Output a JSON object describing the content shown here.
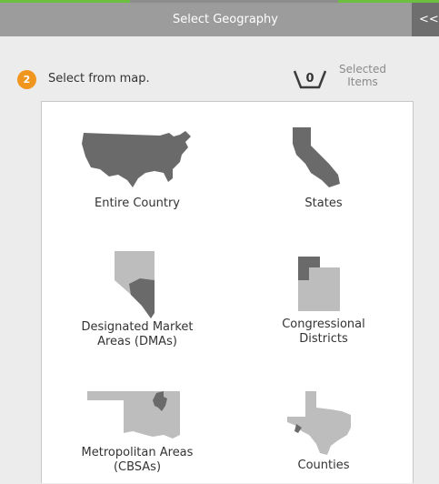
{
  "header": {
    "title": "Select Geography",
    "collapse_label": "<<"
  },
  "step": {
    "number": "2",
    "label": "Select from map."
  },
  "selected": {
    "count": "0",
    "label_line1": "Selected",
    "label_line2": "Items"
  },
  "options": [
    {
      "label": "Entire Country",
      "icon": "usa-map-icon"
    },
    {
      "label": "States",
      "icon": "california-icon"
    },
    {
      "label_line1": "Designated Market",
      "label_line2": "Areas (DMAs)",
      "icon": "nevada-dma-icon"
    },
    {
      "label_line1": "Congressional",
      "label_line2": "Districts",
      "icon": "utah-district-icon"
    },
    {
      "label_line1": "Metropolitan Areas",
      "label_line2": "(CBSAs)",
      "icon": "oklahoma-cbsa-icon"
    },
    {
      "label": "Counties",
      "icon": "texas-county-icon"
    }
  ],
  "colors": {
    "header_bg": "#9c9c9c",
    "collapse_bg": "#6e6e6e",
    "accent_orange": "#f0961e",
    "map_dark": "#6a6a6a",
    "map_light": "#bdbdbd"
  }
}
